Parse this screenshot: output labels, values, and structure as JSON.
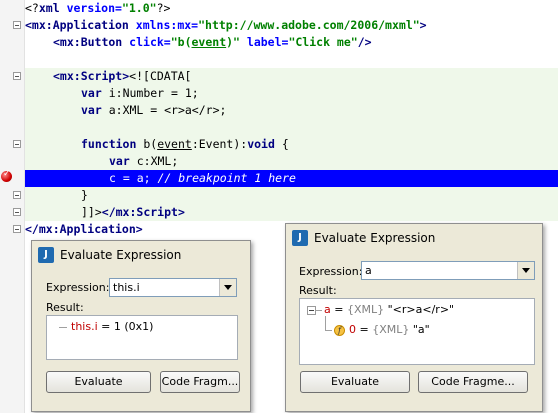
{
  "code": {
    "l1": {
      "a": "<?",
      "b": "xml",
      "c": " version=",
      "d": "\"1.0\"",
      "e": "?>"
    },
    "l2": {
      "a": "<mx:Application",
      "b": " xmlns:mx=",
      "c": "\"http://www.adobe.com/2006/mxml\"",
      "d": ">"
    },
    "l3": {
      "a": "<mx:Button",
      "b": " click=",
      "c": "\"b(",
      "d": "event",
      "e": ")\"",
      "f": " label=",
      "g": "\"Click me\"",
      "h": "/>"
    },
    "l4": {
      "a": "<mx:Script>",
      "b": "<![CDATA["
    },
    "l5": {
      "a": "var ",
      "b": "i",
      "c": ":Number = 1;"
    },
    "l6": {
      "a": "var ",
      "b": "a",
      "c": ":XML = <r>a</r>;"
    },
    "l7": {
      "a": "function ",
      "b": "b",
      "c": "(",
      "d": "event",
      "e": ":Event):",
      "f": "void",
      "g": " {"
    },
    "l8": {
      "a": "var ",
      "b": "c",
      "c": ":XML;"
    },
    "l9": {
      "a": "c = a; ",
      "b": "// breakpoint 1 here"
    },
    "l10": {
      "a": "}"
    },
    "l11": {
      "a": "]]>",
      "b": "</mx:Script>"
    },
    "l12": {
      "a": "</mx:Application>"
    }
  },
  "dialog_left": {
    "title": "Evaluate Expression",
    "expression_label": "Expression:",
    "expression_value": "this.i",
    "result_label": "Result:",
    "result": {
      "name": "this.i",
      "rest": " = 1 (0x1)"
    },
    "evaluate_button": "Evaluate",
    "code_fragment_button": "Code Fragm..."
  },
  "dialog_right": {
    "title": "Evaluate Expression",
    "expression_label": "Expression:",
    "expression_value": "a",
    "result_label": "Result:",
    "root": {
      "name": "a",
      "eq": " = ",
      "type": "{XML}",
      "value": " \"<r>a</r>\""
    },
    "child": {
      "name": "0",
      "eq": " = ",
      "type": "{XML}",
      "value": " \"a\""
    },
    "evaluate_button": "Evaluate",
    "code_fragment_button": "Code Fragme..."
  },
  "colors": {
    "breakpoint_line": "#0000ff",
    "cdata_bg": "#eff8ea",
    "tag": "#000080",
    "attr": "#0000ff",
    "string": "#008000"
  }
}
